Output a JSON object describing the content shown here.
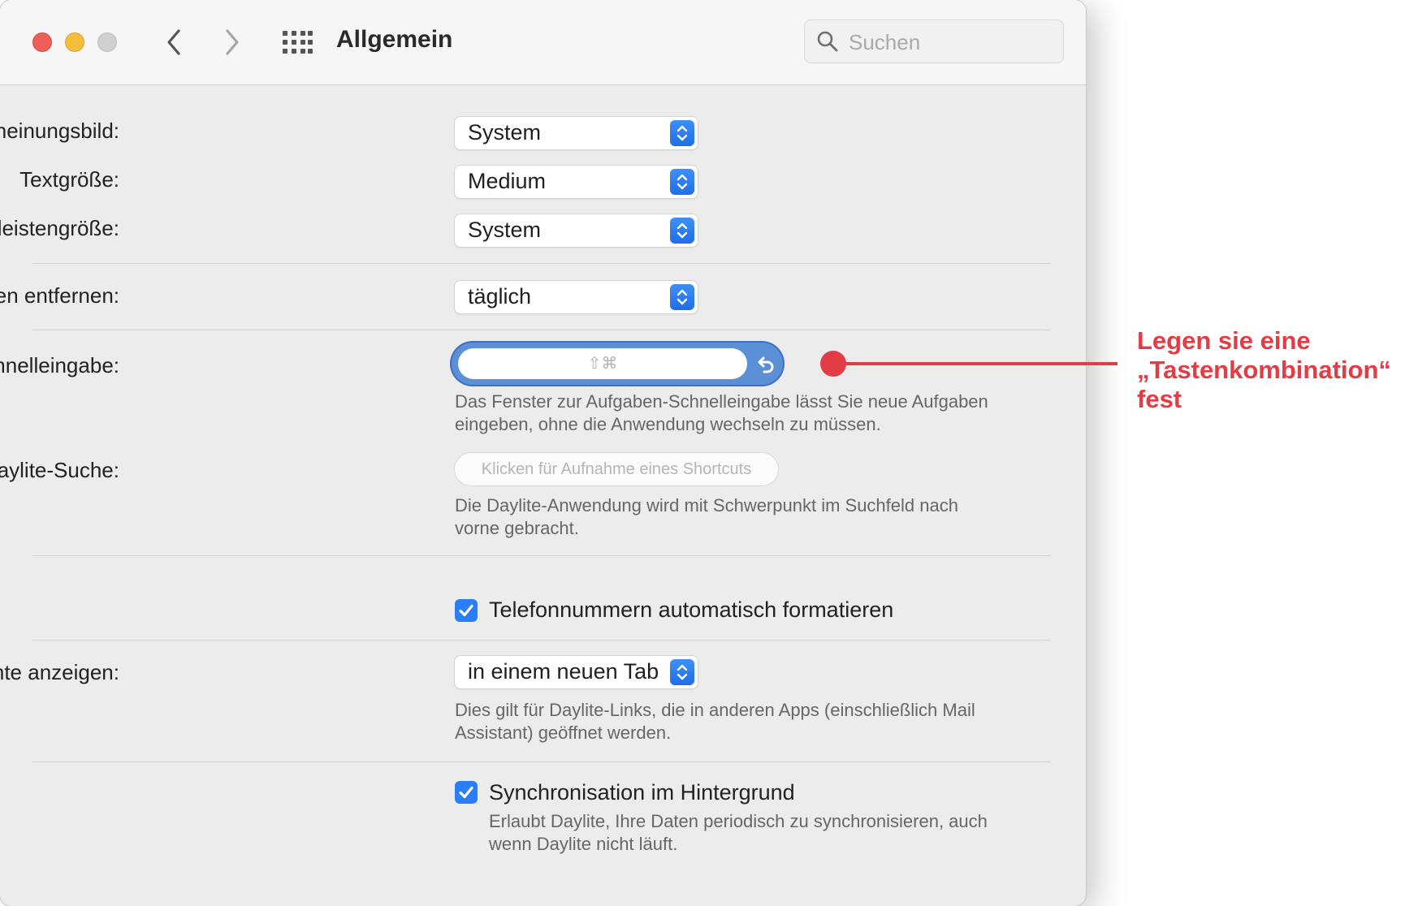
{
  "window": {
    "title": "Allgemein"
  },
  "search": {
    "placeholder": "Suchen"
  },
  "settings": {
    "appearance": {
      "label": "Erscheinungsbild:",
      "value": "System"
    },
    "text_size": {
      "label": "Textgröße:",
      "value": "Medium"
    },
    "sidebar_size": {
      "label": "Seitenleistengröße:",
      "value": "System"
    },
    "remove_completed": {
      "label": "Erledigte Aufgaben entfernen:",
      "value": "täglich"
    },
    "quick_entry_shortcut": {
      "label": "Shortcut für Aufgaben-Schnelleingabe:",
      "value": "⇧⌘",
      "help_line1": "Das Fenster zur Aufgaben-Schnelleingabe lässt Sie neue Aufgaben",
      "help_line2": "eingeben, ohne die Anwendung wechseln zu müssen."
    },
    "search_shortcut": {
      "label": "Shortcut für Daylite-Suche:",
      "placeholder": "Klicken für Aufnahme eines Shortcuts",
      "help_line1": "Die Daylite-Anwendung wird mit Schwerpunkt im Suchfeld nach",
      "help_line2": "vorne gebracht."
    },
    "format_phone": {
      "label": "Telefonnummern automatisch formatieren",
      "checked": true
    },
    "show_items": {
      "label": "Elemente anzeigen:",
      "value": "in einem neuen Tab",
      "help_line1": "Dies gilt für Daylite-Links, die in anderen Apps (einschließlich Mail",
      "help_line2": "Assistant) geöffnet werden."
    },
    "background_sync": {
      "label": "Synchronisation im Hintergrund",
      "checked": true,
      "help_line1": "Erlaubt Daylite, Ihre Daten periodisch zu synchronisieren, auch",
      "help_line2": "wenn Daylite nicht läuft."
    }
  },
  "annotation": {
    "line1": "Legen sie eine",
    "line2": "„Tastenkombination“",
    "line3": "fest",
    "color": "#e23d44"
  },
  "colors": {
    "accent": "#2c7ef6",
    "window_bg": "#ececec"
  }
}
